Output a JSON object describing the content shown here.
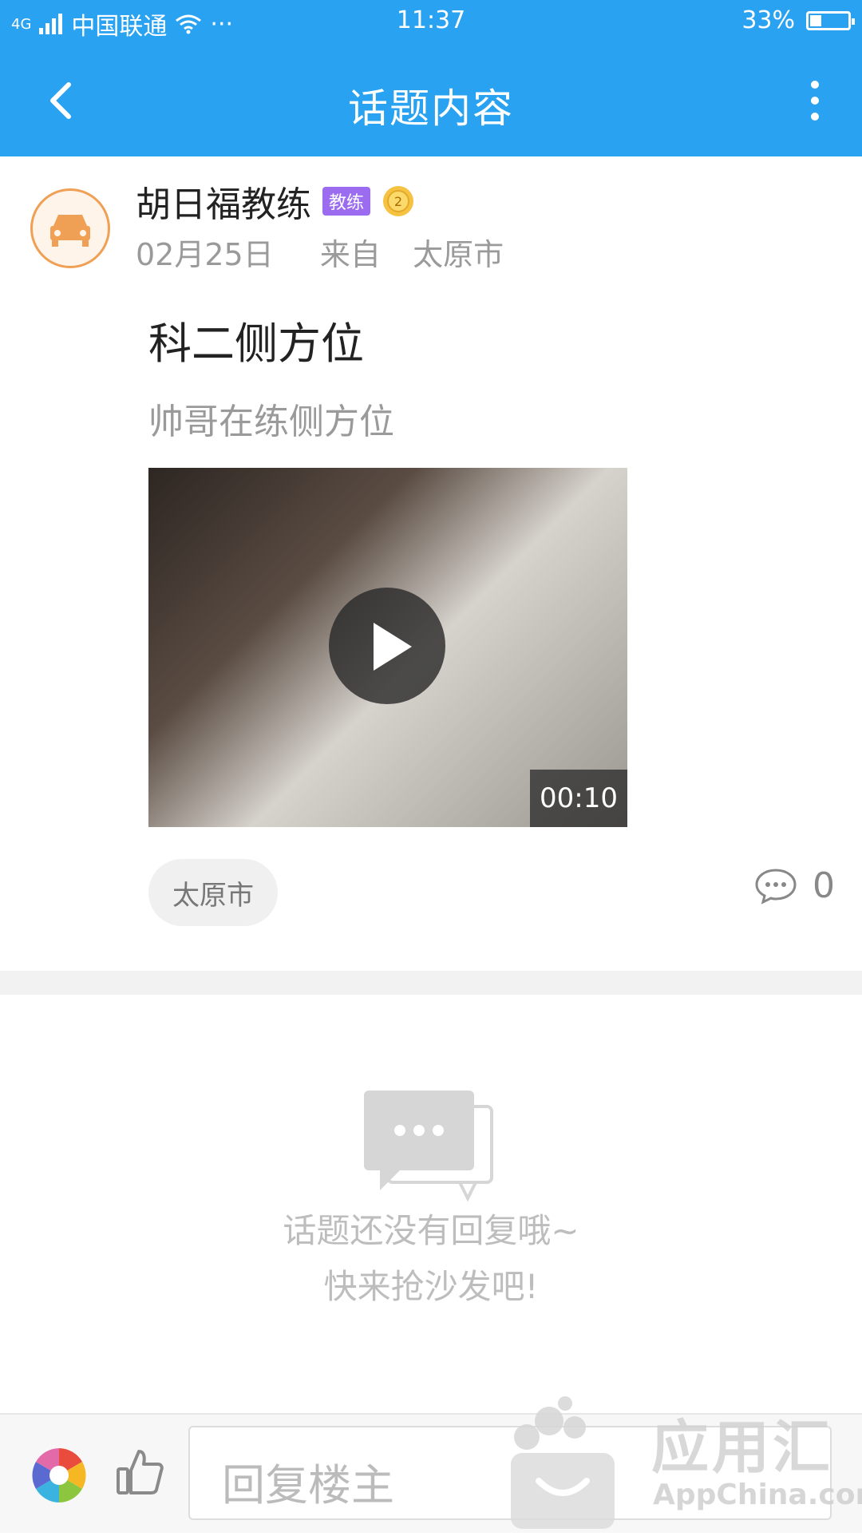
{
  "status_bar": {
    "network": "4G",
    "carrier": "中国联通",
    "dots": "···",
    "time": "11:37",
    "battery": "33%"
  },
  "nav": {
    "title": "话题内容",
    "back_icon": "chevron-left-icon",
    "more_icon": "more-vertical-icon"
  },
  "post": {
    "author": "胡日福教练",
    "role_badge": "教练",
    "medal_level": "2",
    "date": "02月25日",
    "from_label": "来自",
    "location": "太原市",
    "title": "科二侧方位",
    "description": "帅哥在练侧方位",
    "video_duration": "00:10",
    "tag": "太原市",
    "comment_count": "0"
  },
  "empty_state": {
    "line1": "话题还没有回复哦~",
    "line2": "快来抢沙发吧!"
  },
  "bottom_bar": {
    "reply_placeholder": "回复楼主"
  },
  "watermark": {
    "text": "应用汇",
    "sub": "AppChina.com"
  },
  "colors": {
    "primary": "#2aa2f2",
    "avatar_accent": "#f0a055",
    "badge": "#9b6cf0"
  }
}
